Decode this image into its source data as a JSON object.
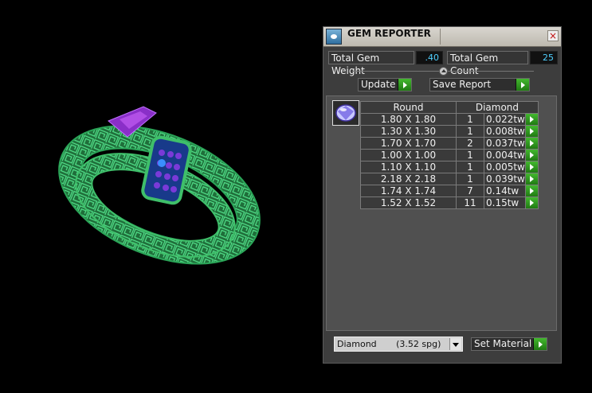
{
  "panel": {
    "title": "GEM REPORTER",
    "close_label": "×",
    "total_weight_label": "Total Gem Weight",
    "total_weight_value": ".40",
    "total_count_label": "Total Gem Count",
    "total_count_value": "25",
    "update_label": "Update",
    "save_report_label": "Save Report",
    "table": {
      "headers": [
        "Round",
        "Diamond"
      ],
      "rows": [
        {
          "size": "1.80 X 1.80",
          "count": "1",
          "weight": "0.022tw"
        },
        {
          "size": "1.30 X 1.30",
          "count": "1",
          "weight": "0.008tw"
        },
        {
          "size": "1.70 X 1.70",
          "count": "2",
          "weight": "0.037tw"
        },
        {
          "size": "1.00 X 1.00",
          "count": "1",
          "weight": "0.004tw"
        },
        {
          "size": "1.10 X 1.10",
          "count": "1",
          "weight": "0.005tw"
        },
        {
          "size": "2.18 X 2.18",
          "count": "1",
          "weight": "0.039tw"
        },
        {
          "size": "1.74 X 1.74",
          "count": "7",
          "weight": "0.14tw"
        },
        {
          "size": "1.52 X 1.52",
          "count": "11",
          "weight": "0.15tw"
        }
      ]
    },
    "material_select": "Diamond       (3.52 spg)",
    "set_material_label": "Set Material"
  },
  "colors": {
    "ring_green": "#3fbf6a",
    "accent_go": "#2f9d1f",
    "value_text": "#4fd0ff",
    "gem_purple": "#9a2fd0"
  }
}
